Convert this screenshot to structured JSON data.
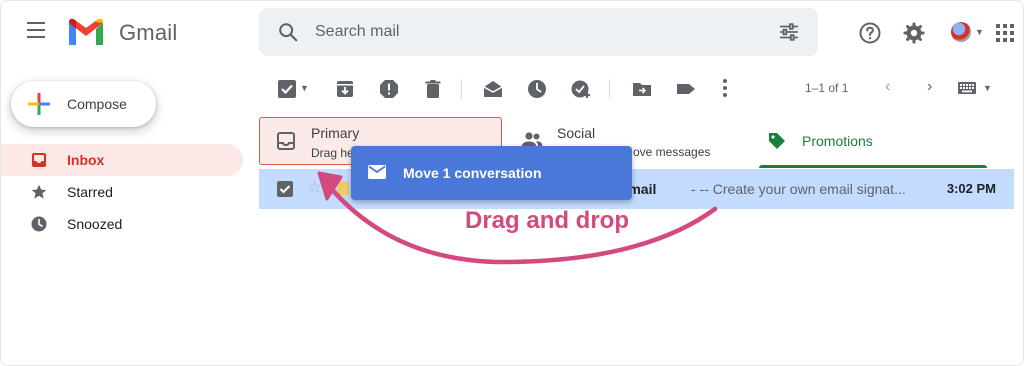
{
  "header": {
    "app_name": "Gmail",
    "search_placeholder": "Search mail"
  },
  "sidebar": {
    "compose_label": "Compose",
    "items": [
      {
        "label": "Inbox",
        "icon": "inbox-icon",
        "active": true
      },
      {
        "label": "Starred",
        "icon": "star-icon",
        "active": false
      },
      {
        "label": "Snoozed",
        "icon": "clock-icon",
        "active": false
      }
    ]
  },
  "toolbar": {
    "pager_text": "1–1 of 1"
  },
  "tabs": [
    {
      "label": "Primary",
      "subtitle": "Drag he",
      "icon": "inbox-icon"
    },
    {
      "label": "Social",
      "subtitle": "ove messages",
      "icon": "people-icon"
    },
    {
      "label": "Promotions",
      "subtitle": "",
      "icon": "tag-icon"
    }
  ],
  "email": {
    "subject": "al email",
    "snippet": "- -- Create your own email signat...",
    "time": "3:02 PM"
  },
  "drag_popup": {
    "label": "Move 1 conversation",
    "icon": "mail-icon"
  },
  "annotation": {
    "text": "Drag and drop"
  },
  "colors": {
    "accent_red": "#d93025",
    "selected_row": "#c2dbff",
    "drag_popup_bg": "#4a78d9",
    "annotation_pink": "#d24a7f",
    "promotions_green": "#188038"
  }
}
